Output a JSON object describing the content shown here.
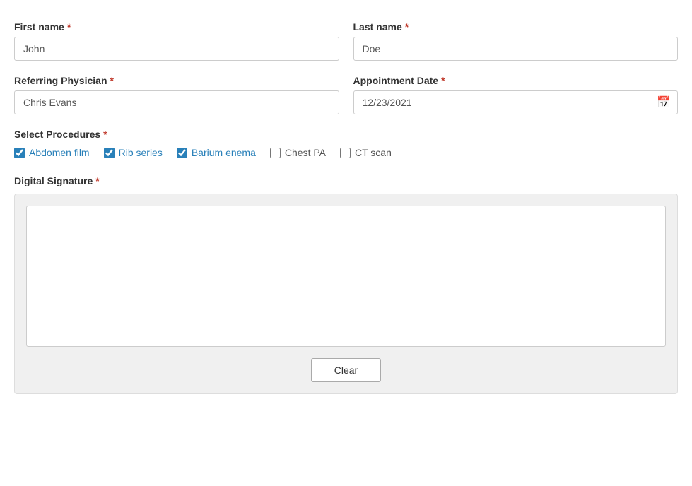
{
  "form": {
    "first_name_label": "First name",
    "last_name_label": "Last name",
    "referring_physician_label": "Referring Physician",
    "appointment_date_label": "Appointment Date",
    "select_procedures_label": "Select Procedures",
    "digital_signature_label": "Digital Signature",
    "required_star": "*",
    "first_name_value": "John",
    "last_name_value": "Doe",
    "referring_physician_value": "Chris Evans",
    "appointment_date_value": "12/23/2021",
    "clear_button_label": "Clear",
    "procedures": [
      {
        "id": "abdomen_film",
        "label": "Abdomen film",
        "checked": true
      },
      {
        "id": "rib_series",
        "label": "Rib series",
        "checked": true
      },
      {
        "id": "barium_enema",
        "label": "Barium enema",
        "checked": true
      },
      {
        "id": "chest_pa",
        "label": "Chest PA",
        "checked": false
      },
      {
        "id": "ct_scan",
        "label": "CT scan",
        "checked": false
      }
    ]
  }
}
